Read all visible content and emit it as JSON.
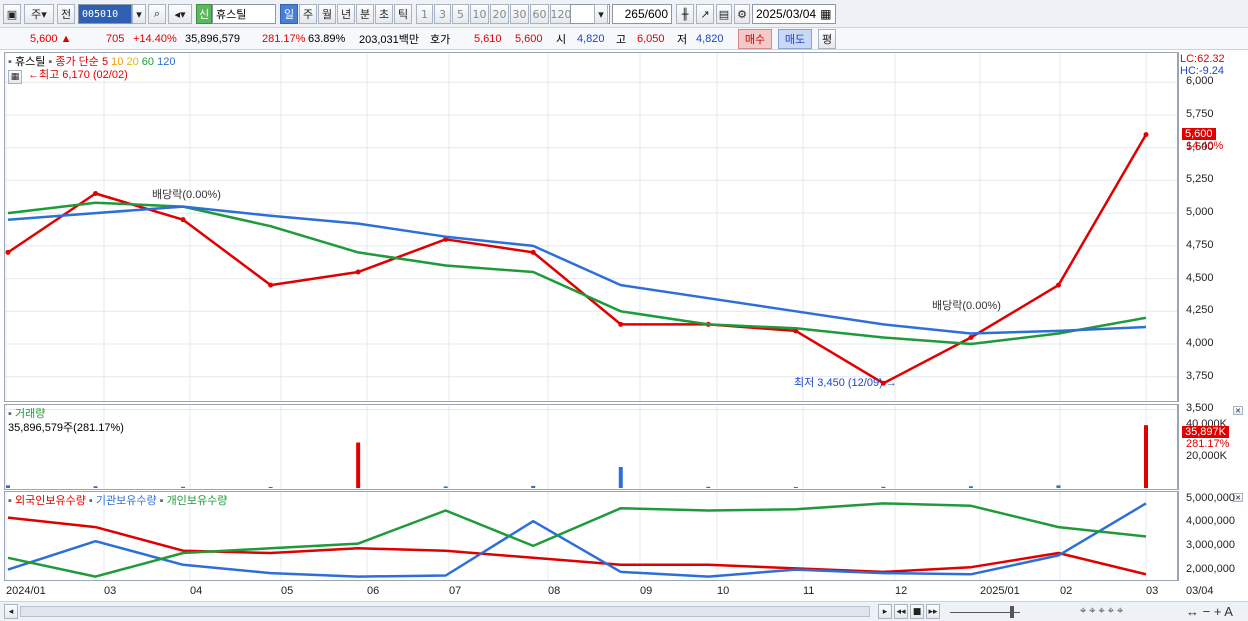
{
  "toolbar": {
    "market": "주",
    "prev": "전",
    "code": "005010",
    "new_badge": "신",
    "stock_name": "휴스틸",
    "periods": [
      "일",
      "주",
      "월",
      "년",
      "분",
      "초",
      "틱"
    ],
    "intervals": [
      "1",
      "3",
      "5",
      "10",
      "20",
      "30",
      "60",
      "120"
    ],
    "count": "265",
    "count_total": "/600",
    "date": "2025/03/04"
  },
  "ticker": {
    "price": "5,600",
    "change": "705",
    "change_pct": "+14.40%",
    "volume": "35,896,579",
    "vol_ratio": "281.17%",
    "turnover": "63.89%",
    "amount": "203,031백만",
    "quote_label": "호가",
    "ask": "5,610",
    "bid": "5,600",
    "open_label": "시",
    "open": "4,820",
    "high_label": "고",
    "high": "6,050",
    "low_label": "저",
    "low": "4,820",
    "buy_label": "매수",
    "sell_label": "매도",
    "eval_label": "평"
  },
  "price_panel": {
    "legend_name": "휴스틸",
    "legend_ma_label": "종가 단순",
    "legend_ma": [
      {
        "period": "5",
        "color": "#e00000"
      },
      {
        "period": "10",
        "color": "#f2a000"
      },
      {
        "period": "20",
        "color": "#e8d800"
      },
      {
        "period": "60",
        "color": "#1f9a3a"
      },
      {
        "period": "120",
        "color": "#2d6fd6"
      }
    ],
    "high_note": "최고 6,170 (02/02)",
    "low_note": "최저 3,450 (12/09)",
    "div_note_1": "배당락(0.00%)",
    "div_note_2": "배당락(0.00%)",
    "lc": "LC:62.32",
    "hc": "HC:-9.24",
    "last_price_tag": "5,600",
    "last_pct_tag": "14.40%",
    "y_ticks": [
      "6,000",
      "5,750",
      "5,500",
      "5,250",
      "5,000",
      "4,750",
      "4,500",
      "4,250",
      "4,000",
      "3,750",
      "3,500"
    ]
  },
  "volume_panel": {
    "title": "거래량",
    "value": "35,896,579주(281.17%)",
    "y_ticks": [
      "40,000K",
      "20,000K"
    ],
    "tag_value": "35,897K",
    "tag_pct": "281.17%"
  },
  "holdings_panel": {
    "legend": [
      "외국인보유수량",
      "기관보유수량",
      "개인보유수량"
    ],
    "colors": [
      "#e00000",
      "#2d6fd6",
      "#1f9a3a"
    ],
    "y_ticks": [
      "5,000,000",
      "4,000,000",
      "3,000,000",
      "2,000,000"
    ]
  },
  "x_axis": [
    "2024/01",
    "03",
    "04",
    "05",
    "06",
    "07",
    "08",
    "09",
    "10",
    "11",
    "12",
    "2025/01",
    "02",
    "03",
    "03/04"
  ],
  "chart_data": [
    {
      "type": "line",
      "title": "휴스틸",
      "x": [
        "2024/01",
        "03",
        "04",
        "05",
        "06",
        "07",
        "08",
        "09",
        "10",
        "11",
        "12",
        "2025/01",
        "02",
        "03"
      ],
      "series": [
        {
          "name": "종가",
          "values": [
            4700,
            5150,
            4950,
            4450,
            4550,
            4800,
            4700,
            4150,
            4150,
            4100,
            3700,
            4050,
            4450,
            5600
          ]
        },
        {
          "name": "60",
          "values": [
            5000,
            5080,
            5050,
            4900,
            4700,
            4600,
            4550,
            4250,
            4150,
            4120,
            4050,
            4000,
            4080,
            4200
          ]
        },
        {
          "name": "120",
          "values": [
            4950,
            5000,
            5050,
            4980,
            4920,
            4820,
            4750,
            4450,
            4350,
            4250,
            4150,
            4080,
            4100,
            4130
          ]
        }
      ],
      "ylim": [
        3450,
        6170
      ]
    },
    {
      "type": "bar",
      "title": "거래량",
      "categories": [
        "2024/01",
        "03",
        "04",
        "05",
        "06",
        "07",
        "08",
        "09",
        "10",
        "11",
        "12",
        "2025/01",
        "02",
        "03"
      ],
      "series": [
        {
          "name": "거래량",
          "values": [
            1500,
            1000,
            700,
            600,
            26000,
            900,
            1200,
            12000,
            700,
            600,
            700,
            1000,
            1500,
            35897
          ]
        }
      ],
      "ylim": [
        0,
        40000
      ]
    },
    {
      "type": "line",
      "title": "외국인보유수량 / 기관보유수량 / 개인보유수량",
      "x": [
        "2024/01",
        "03",
        "04",
        "05",
        "06",
        "07",
        "08",
        "09",
        "10",
        "11",
        "12",
        "2025/01",
        "02",
        "03"
      ],
      "series": [
        {
          "name": "외국인보유수량",
          "values": [
            4200000,
            3800000,
            2800000,
            2700000,
            2900000,
            2800000,
            2500000,
            2200000,
            2200000,
            2050000,
            1900000,
            2100000,
            2700000,
            1800000
          ]
        },
        {
          "name": "기관보유수량",
          "values": [
            2000000,
            3200000,
            2200000,
            1850000,
            1700000,
            1750000,
            4050000,
            1900000,
            1700000,
            2000000,
            1850000,
            1800000,
            2600000,
            4800000
          ]
        },
        {
          "name": "개인보유수량",
          "values": [
            2500000,
            1700000,
            2700000,
            2900000,
            3100000,
            4500000,
            3000000,
            4600000,
            4500000,
            4550000,
            4800000,
            4700000,
            3800000,
            3400000
          ]
        }
      ],
      "ylim": [
        1600000,
        5200000
      ]
    }
  ]
}
